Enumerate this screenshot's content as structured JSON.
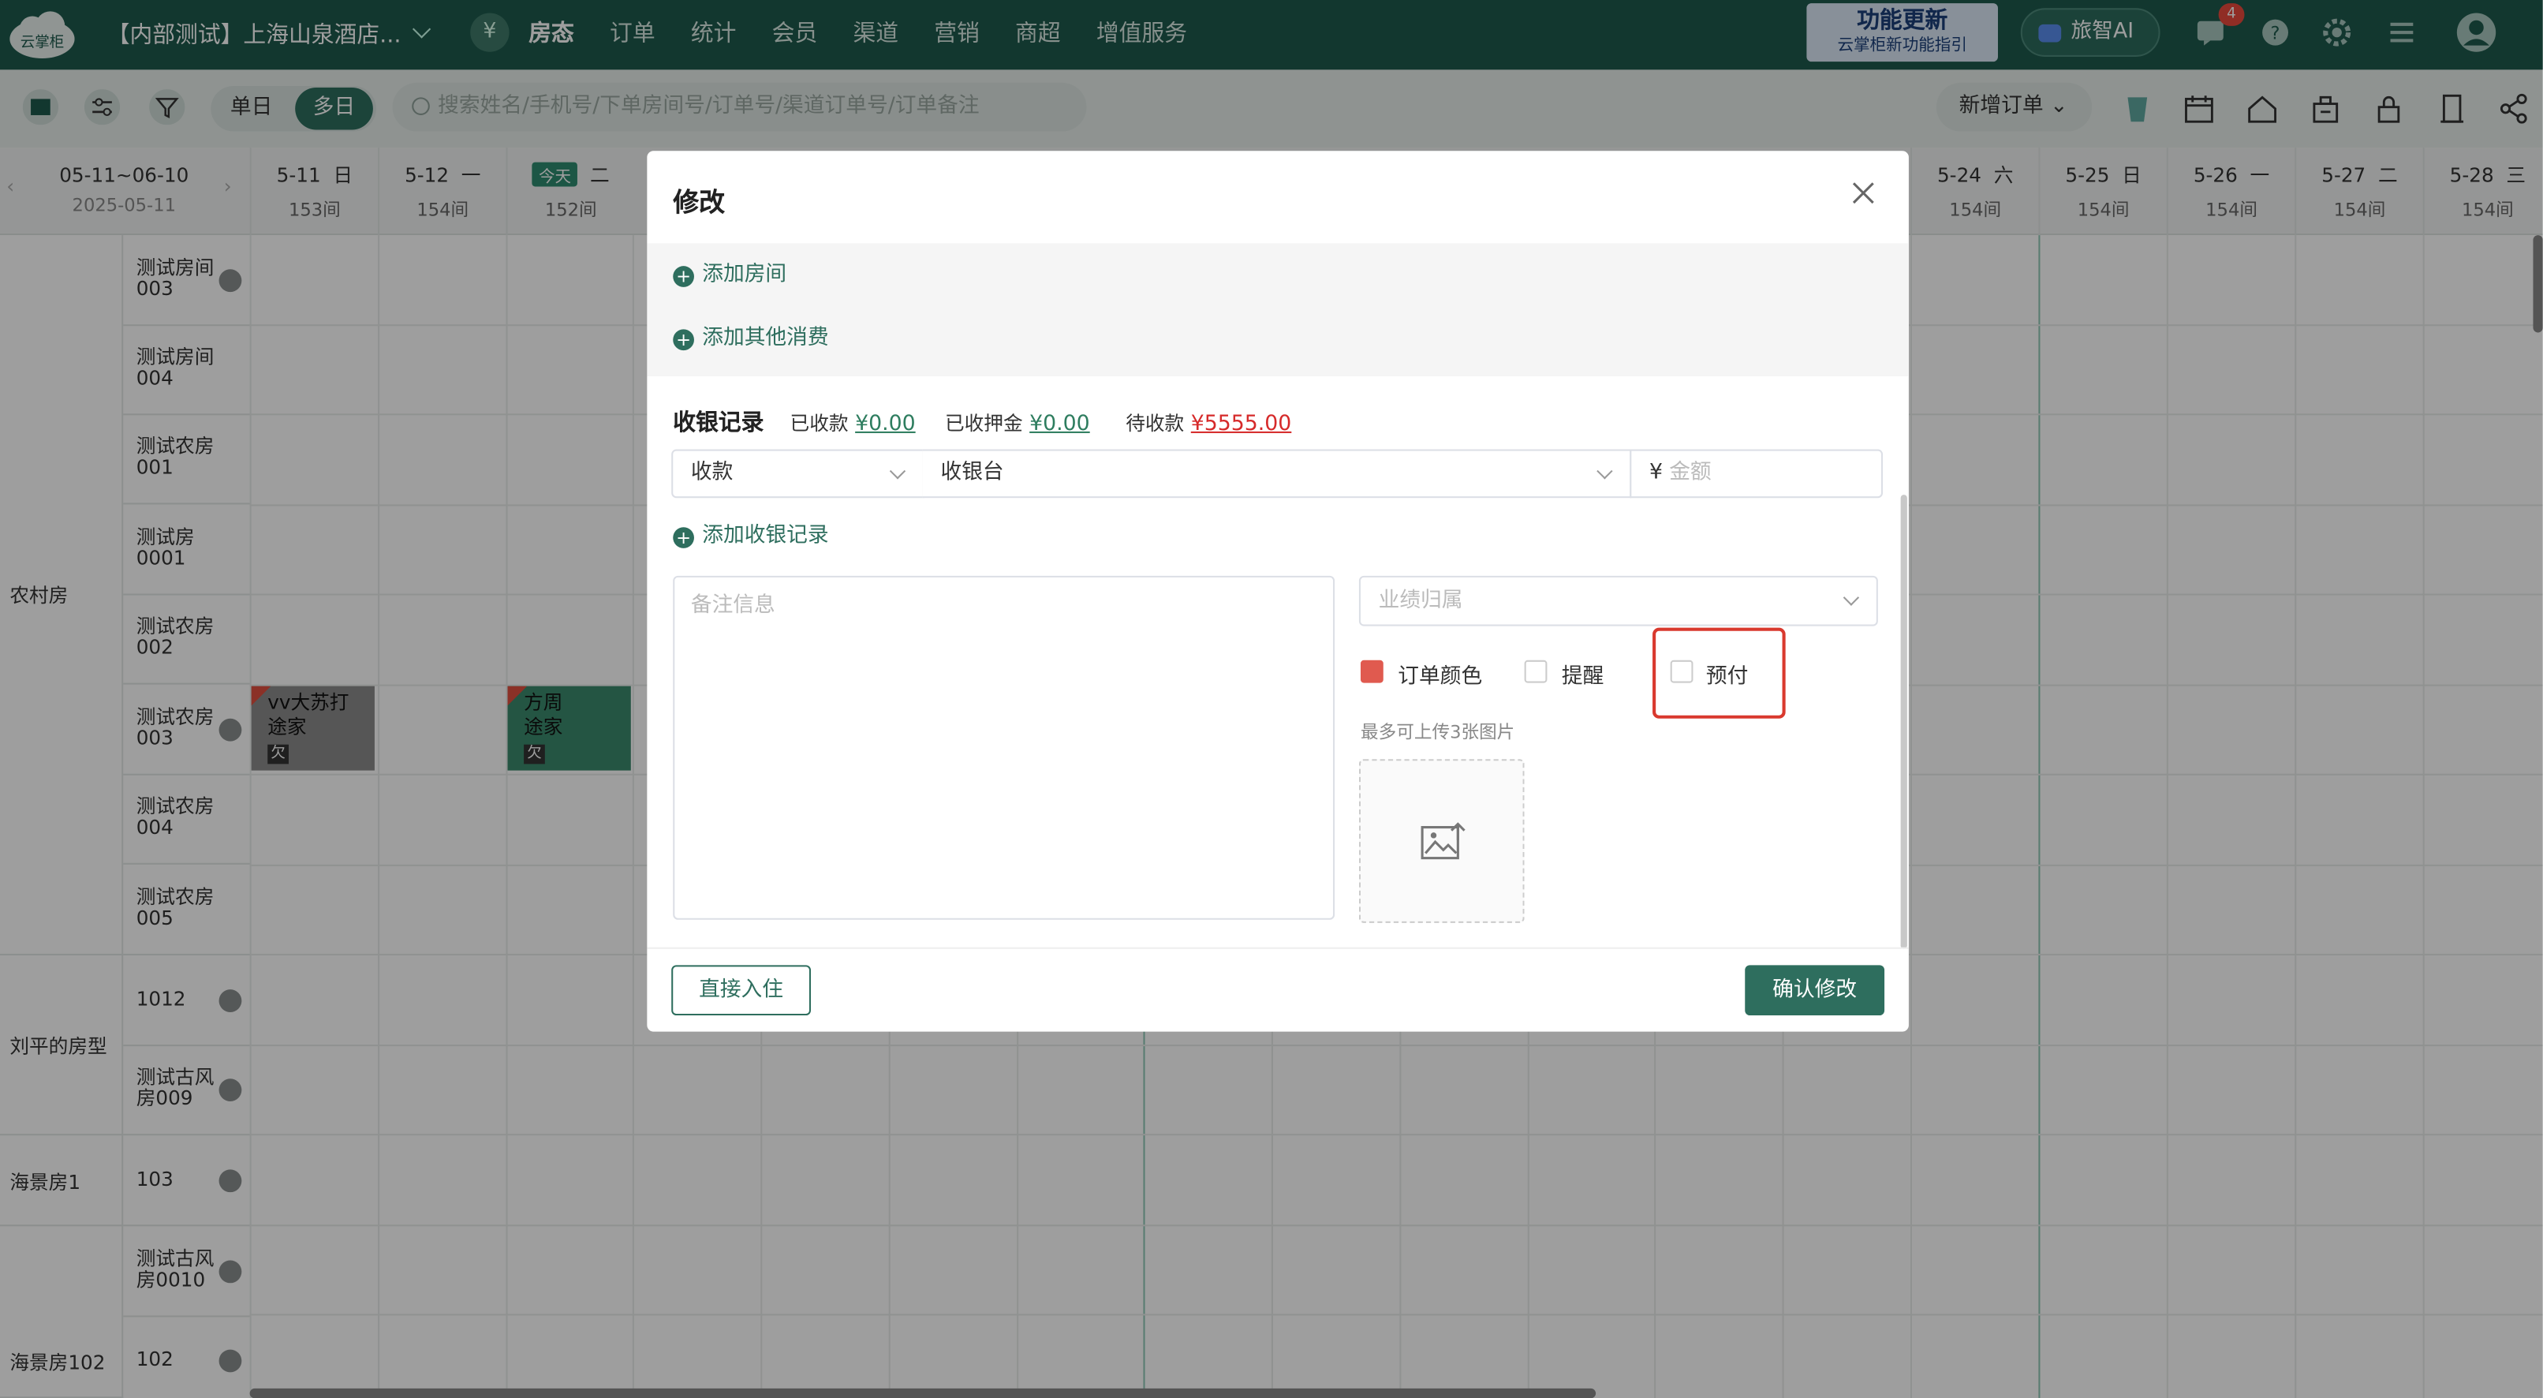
{
  "header": {
    "logo_text": "云掌柜",
    "hotel_name": "【内部测试】上海山泉酒店...",
    "nav": [
      "房态",
      "订单",
      "统计",
      "会员",
      "渠道",
      "营销",
      "商超",
      "增值服务"
    ],
    "promo_title": "功能更新",
    "promo_sub": "云掌柜新功能指引",
    "ai_label": "旅智AI",
    "msg_count": "4"
  },
  "toolbar": {
    "single_day": "单日",
    "multi_day": "多日",
    "search_placeholder": "搜索姓名/手机号/下单房间号/订单号/渠道订单号/订单备注",
    "new_order": "新增订单"
  },
  "calendar": {
    "range": "05-11~06-10",
    "date": "2025-05-11",
    "today_label": "今天",
    "days": [
      {
        "date": "5-11",
        "wd": "日",
        "count": "153间"
      },
      {
        "date": "5-12",
        "wd": "一",
        "count": "154间"
      },
      {
        "date": "",
        "wd": "二",
        "count": "152间"
      },
      {
        "date": "5-24",
        "wd": "六",
        "count": "154间"
      },
      {
        "date": "5-25",
        "wd": "日",
        "count": "154间"
      },
      {
        "date": "5-26",
        "wd": "一",
        "count": "154间"
      },
      {
        "date": "5-27",
        "wd": "二",
        "count": "154间"
      },
      {
        "date": "5-28",
        "wd": "三",
        "count": "154间"
      }
    ]
  },
  "room_types": [
    "农村房",
    "刘平的房型",
    "海景房1",
    "海景房102"
  ],
  "rooms": [
    "测试房间003",
    "测试房间004",
    "测试农房001",
    "测试房0001",
    "测试农房002",
    "测试农房003",
    "测试农房004",
    "测试农房005",
    "1012",
    "测试古风房009",
    "103",
    "测试古风房0010",
    "102"
  ],
  "bookings": [
    {
      "name": "vv大苏打",
      "channel": "途家",
      "tag": "欠"
    },
    {
      "name": "方周",
      "channel": "途家",
      "tag": "欠"
    }
  ],
  "modal": {
    "title": "修改",
    "add_room": "添加房间",
    "add_other": "添加其他消费",
    "cash_title": "收银记录",
    "received_label": "已收款",
    "received": "¥0.00",
    "deposit_label": "已收押金",
    "deposit": "¥0.00",
    "pending_label": "待收款",
    "pending": "¥5555.00",
    "pay_type": "收款",
    "pay_channel": "收银台",
    "currency": "¥",
    "amount_placeholder": "金额",
    "add_cash": "添加收银记录",
    "notes_placeholder": "备注信息",
    "perf_placeholder": "业绩归属",
    "order_color": "订单颜色",
    "remind": "提醒",
    "prepay": "预付",
    "upload_hint": "最多可上传3张图片",
    "checkin_btn": "直接入住",
    "confirm_btn": "确认修改"
  }
}
